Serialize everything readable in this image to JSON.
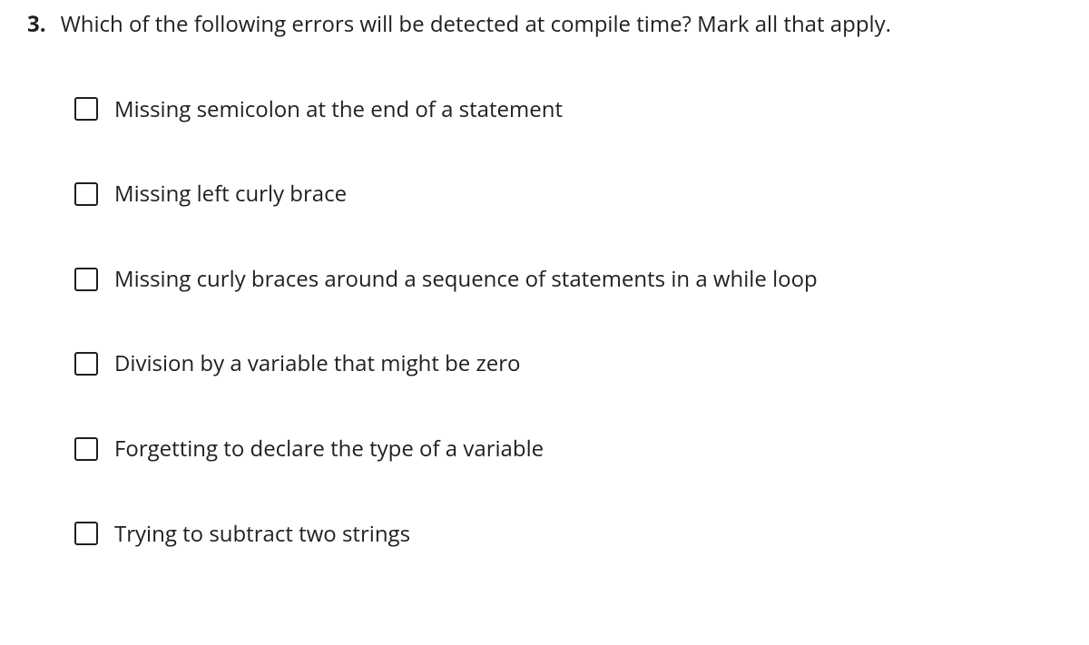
{
  "question": {
    "number": "3.",
    "text": "Which of the following errors will be detected at compile time? Mark all that apply."
  },
  "options": [
    {
      "label": "Missing semicolon at the end of a statement"
    },
    {
      "label": "Missing left curly brace"
    },
    {
      "label": "Missing curly braces around a sequence of statements in a while loop"
    },
    {
      "label": "Division by a variable that might be zero"
    },
    {
      "label": "Forgetting to declare the type of a variable"
    },
    {
      "label": "Trying to subtract two strings"
    }
  ]
}
